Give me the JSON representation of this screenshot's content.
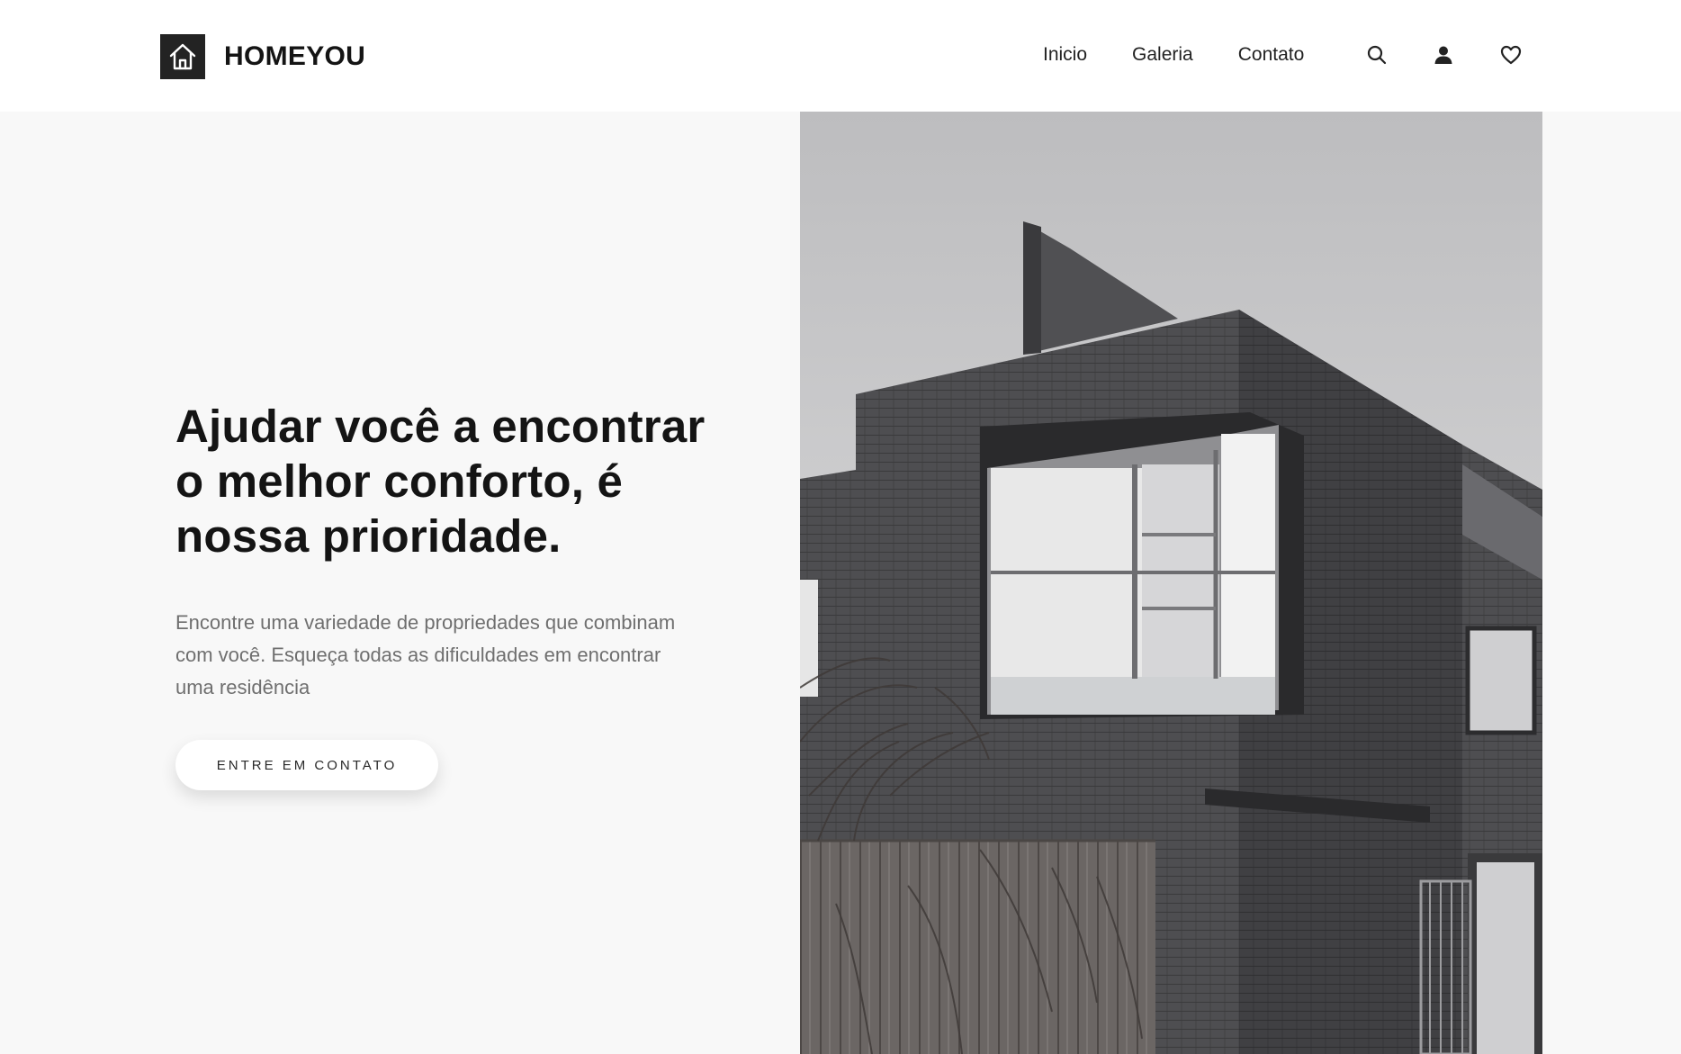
{
  "brand": {
    "name": "HOMEYOU",
    "logo_icon": "house-icon"
  },
  "nav": {
    "items": [
      "Inicio",
      "Galeria",
      "Contato"
    ]
  },
  "header_icons": [
    "search-icon",
    "user-icon",
    "heart-icon"
  ],
  "hero": {
    "headline_lines": [
      "Ajudar você a encontrar",
      "o melhor conforto, é",
      "nossa prioridade."
    ],
    "subtitle": "Encontre uma variedade de propriedades que combinam com você. Esqueça todas as dificuldades em encontrar uma residência",
    "cta_label": "ENTRE EM CONTATO"
  },
  "colors": {
    "page_background": "#f8f8f8",
    "header_background": "#ffffff",
    "text_primary": "#141414",
    "text_secondary": "#6f6f6f",
    "logo_box": "#232323"
  }
}
